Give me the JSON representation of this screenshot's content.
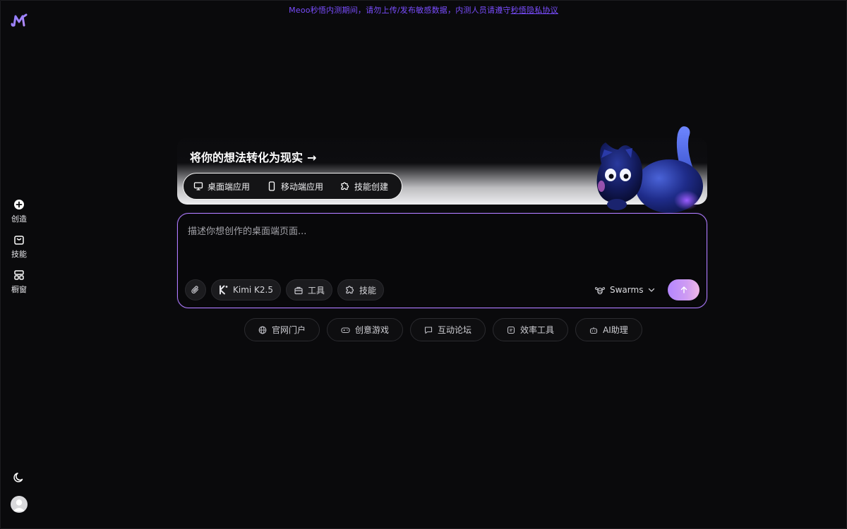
{
  "notice": {
    "text": "Meoo秒悟内测期间，请勿上传/发布敏感数据，内测人员请遵守",
    "link": "秒悟隐私协议"
  },
  "sidebar": {
    "items": [
      {
        "label": "创造",
        "icon": "plus-circle-icon"
      },
      {
        "label": "技能",
        "icon": "bag-icon"
      },
      {
        "label": "橱窗",
        "icon": "grid-icon"
      }
    ],
    "theme_icon": "moon-icon",
    "avatar_icon": "user-avatar-icon"
  },
  "banner": {
    "title": "将你的想法转化为现实",
    "arrow": "→",
    "chips": [
      {
        "label": "桌面端应用",
        "icon": "monitor-icon"
      },
      {
        "label": "移动端应用",
        "icon": "phone-icon"
      },
      {
        "label": "技能创建",
        "icon": "puzzle-icon"
      }
    ]
  },
  "composer": {
    "placeholder": "描述你想创作的桌面端页面...",
    "value": "",
    "attach_icon": "paperclip-icon",
    "model_label": "Kimi K2.5",
    "tools_label": "工具",
    "skills_label": "技能",
    "swarms_label": "Swarms",
    "send_icon": "arrow-up-icon"
  },
  "suggestions": [
    {
      "label": "官网门户",
      "icon": "globe-icon"
    },
    {
      "label": "创意游戏",
      "icon": "gamepad-icon"
    },
    {
      "label": "互动论坛",
      "icon": "chat-icon"
    },
    {
      "label": "效率工具",
      "icon": "tool-icon"
    },
    {
      "label": "AI助理",
      "icon": "robot-icon"
    }
  ],
  "colors": {
    "accent": "#7a4dff",
    "input_border": "#b07cff",
    "background": "#0a0a0c"
  }
}
